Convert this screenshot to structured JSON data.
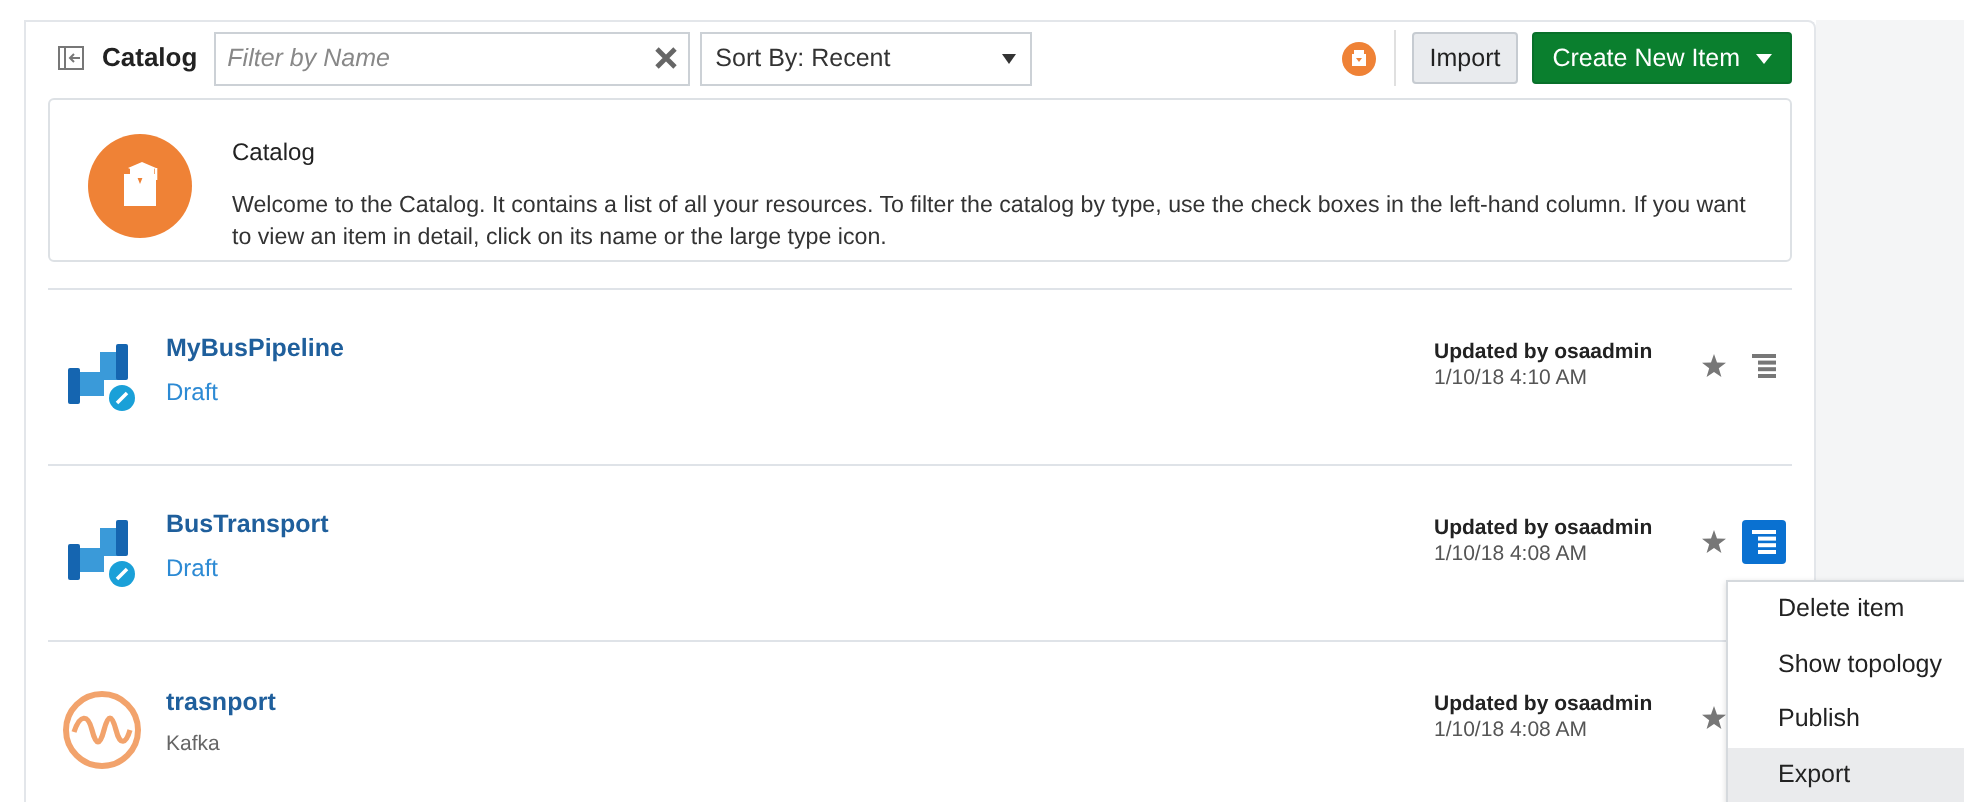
{
  "toolbar": {
    "title": "Catalog",
    "filter": {
      "placeholder": "Filter by Name"
    },
    "sort": {
      "value": "Sort By: Recent"
    },
    "import_button": "Import",
    "create_button": "Create New Item"
  },
  "info": {
    "title": "Catalog",
    "text": "Welcome to the Catalog. It contains a list of all your resources. To filter the catalog by type, use the check boxes in the left-hand column. If you want to view an item in detail, click on its name or the large type icon."
  },
  "items": [
    {
      "kind": "pipeline",
      "name": "MyBusPipeline",
      "status": "Draft",
      "updated_by": "Updated by osaadmin",
      "updated_at": "1/10/18 4:10 AM",
      "menu_button": true,
      "menu_open": false
    },
    {
      "kind": "pipeline",
      "name": "BusTransport",
      "status": "Draft",
      "updated_by": "Updated by osaadmin",
      "updated_at": "1/10/18 4:08 AM",
      "menu_button": true,
      "menu_open": true
    },
    {
      "kind": "kafka",
      "name": "trasnport",
      "status": "Kafka",
      "updated_by": "Updated by osaadmin",
      "updated_at": "1/10/18 4:08 AM",
      "menu_button": false,
      "menu_open": false
    }
  ],
  "menu": [
    {
      "label": "Delete item",
      "highlighted": false
    },
    {
      "label": "Show topology",
      "highlighted": false
    },
    {
      "label": "Publish",
      "highlighted": false
    },
    {
      "label": "Export",
      "highlighted": true
    }
  ]
}
